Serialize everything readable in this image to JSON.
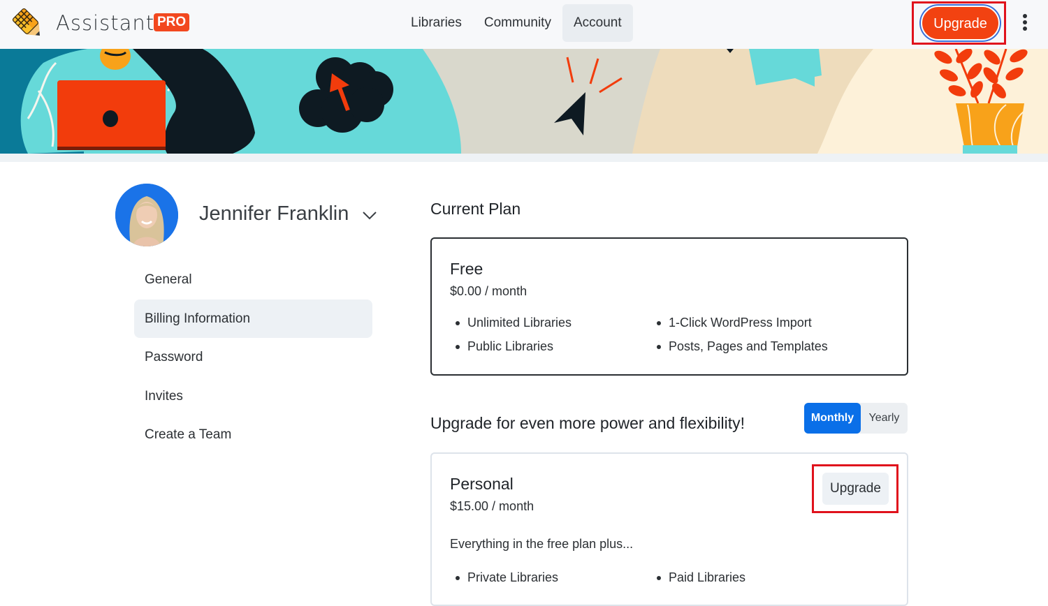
{
  "header": {
    "brand": "Assistant",
    "badge": "PRO",
    "nav": [
      {
        "label": "Libraries",
        "active": false
      },
      {
        "label": "Community",
        "active": false
      },
      {
        "label": "Account",
        "active": true
      }
    ],
    "upgrade_label": "Upgrade",
    "menu_icon": "kebab-vertical-icon"
  },
  "banner": {
    "illustration": "person-with-laptop, cloud-upload, cursor-click, chat-bubble, potted-plant"
  },
  "user": {
    "name": "Jennifer Franklin",
    "dropdown_icon": "chevron-down-icon"
  },
  "sidebar": {
    "items": [
      {
        "label": "General",
        "active": false
      },
      {
        "label": "Billing Information",
        "active": true
      },
      {
        "label": "Password",
        "active": false
      },
      {
        "label": "Invites",
        "active": false
      },
      {
        "label": "Create a Team",
        "active": false
      }
    ]
  },
  "current_plan": {
    "title": "Current Plan",
    "name": "Free",
    "price": "$0.00 / month",
    "features": [
      "Unlimited Libraries",
      "1-Click WordPress Import",
      "Public Libraries",
      "Posts, Pages and Templates"
    ]
  },
  "upgrade_section": {
    "title": "Upgrade for even more power and flexibility!",
    "toggle": {
      "monthly": "Monthly",
      "yearly": "Yearly",
      "selected": "Monthly"
    },
    "plans": [
      {
        "name": "Personal",
        "price": "$15.00 / month",
        "description": "Everything in the free plan plus...",
        "features": [
          "Private Libraries",
          "Paid Libraries"
        ],
        "button": "Upgrade"
      }
    ]
  },
  "colors": {
    "accent_orange": "#f24211",
    "toggle_blue": "#0a6fe8",
    "highlight_red": "#e0121c",
    "teal": "#66d9d9"
  }
}
